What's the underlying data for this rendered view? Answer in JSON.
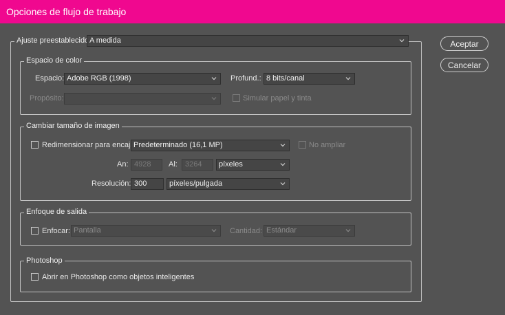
{
  "window": {
    "title": "Opciones de flujo de trabajo"
  },
  "preset": {
    "label": "Ajuste preestablecido:",
    "value": "A medida"
  },
  "buttons": {
    "accept": "Aceptar",
    "cancel": "Cancelar"
  },
  "color_space": {
    "legend": "Espacio de color",
    "space_label": "Espacio:",
    "space_value": "Adobe RGB (1998)",
    "depth_label": "Profund.:",
    "depth_value": "8 bits/canal",
    "intent_label": "Propósito:",
    "intent_value": "",
    "simulate_label": "Simular papel y tinta"
  },
  "resize": {
    "legend": "Cambiar tamaño de imagen",
    "fit_label": "Redimensionar para encajar:",
    "fit_value": "Predeterminado (16,1 MP)",
    "no_enlarge_label": "No ampliar",
    "width_label": "An:",
    "width_value": "4928",
    "height_label": "Al:",
    "height_value": "3264",
    "unit_value": "píxeles",
    "resolution_label": "Resolución:",
    "resolution_value": "300",
    "resolution_unit": "píxeles/pulgada"
  },
  "sharpen": {
    "legend": "Enfoque de salida",
    "sharpen_label": "Enfocar:",
    "sharpen_value": "Pantalla",
    "amount_label": "Cantidad:",
    "amount_value": "Estándar"
  },
  "photoshop": {
    "legend": "Photoshop",
    "smart_label": "Abrir en Photoshop como objetos inteligentes"
  },
  "icons": {
    "dropdown": "chevron-down-icon"
  },
  "colors": {
    "titlebar": "#f0088f",
    "background": "#535353"
  }
}
